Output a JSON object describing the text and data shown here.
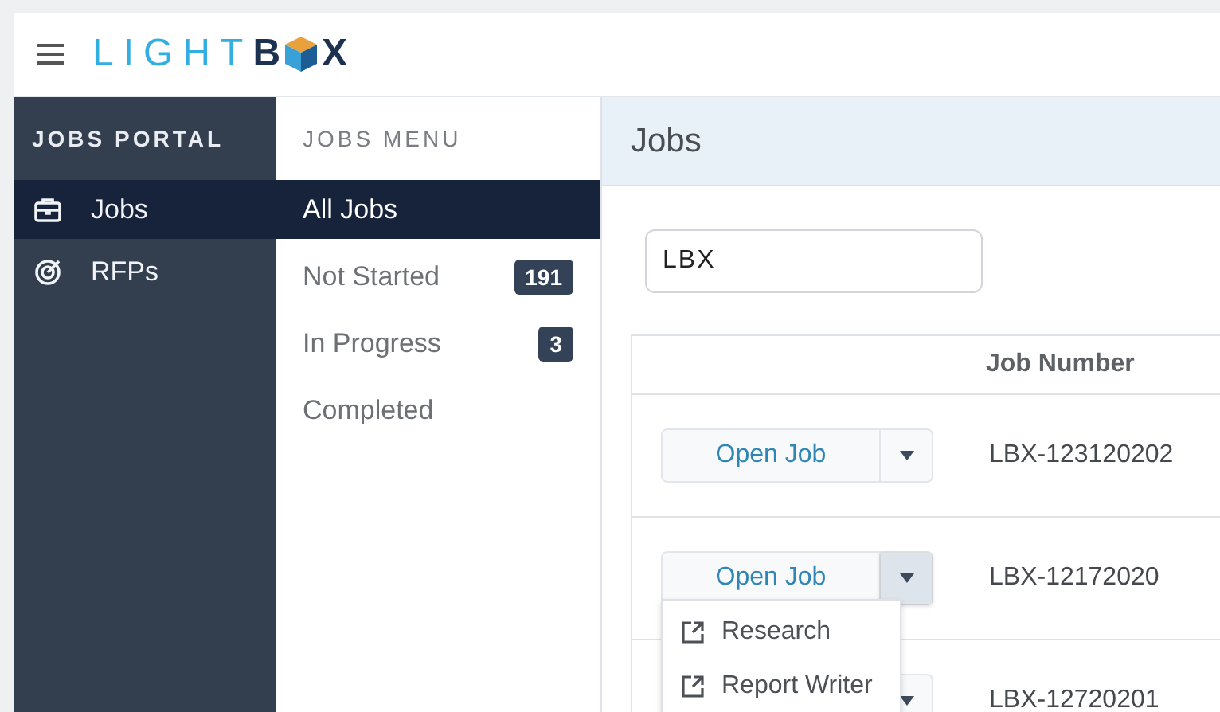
{
  "header": {
    "logo": {
      "light": "LIGHT",
      "bold_before": "B",
      "bold_after": "X"
    }
  },
  "portal": {
    "title": "JOBS PORTAL",
    "items": [
      {
        "label": "Jobs",
        "kind": "briefcase",
        "selected": true
      },
      {
        "label": "RFPs",
        "kind": "target",
        "selected": false
      }
    ]
  },
  "jobs_menu": {
    "title": "JOBS MENU",
    "items": [
      {
        "label": "All Jobs",
        "selected": true
      },
      {
        "label": "Not Started",
        "count": "191",
        "selected": false
      },
      {
        "label": "In Progress",
        "count": "3",
        "selected": false
      },
      {
        "label": "Completed",
        "selected": false
      }
    ]
  },
  "main": {
    "title": "Jobs",
    "search": {
      "value": "LBX"
    },
    "table": {
      "columns": [
        "Job Number"
      ],
      "rows": [
        {
          "button": "Open Job",
          "job_number": "LBX-123120202",
          "expanded": false
        },
        {
          "button": "Open Job",
          "job_number": "LBX-12172020",
          "expanded": true
        },
        {
          "job_number": "LBX-12720201",
          "expanded": false
        }
      ]
    },
    "dropdown": {
      "items": [
        "Research",
        "Report Writer"
      ]
    }
  }
}
